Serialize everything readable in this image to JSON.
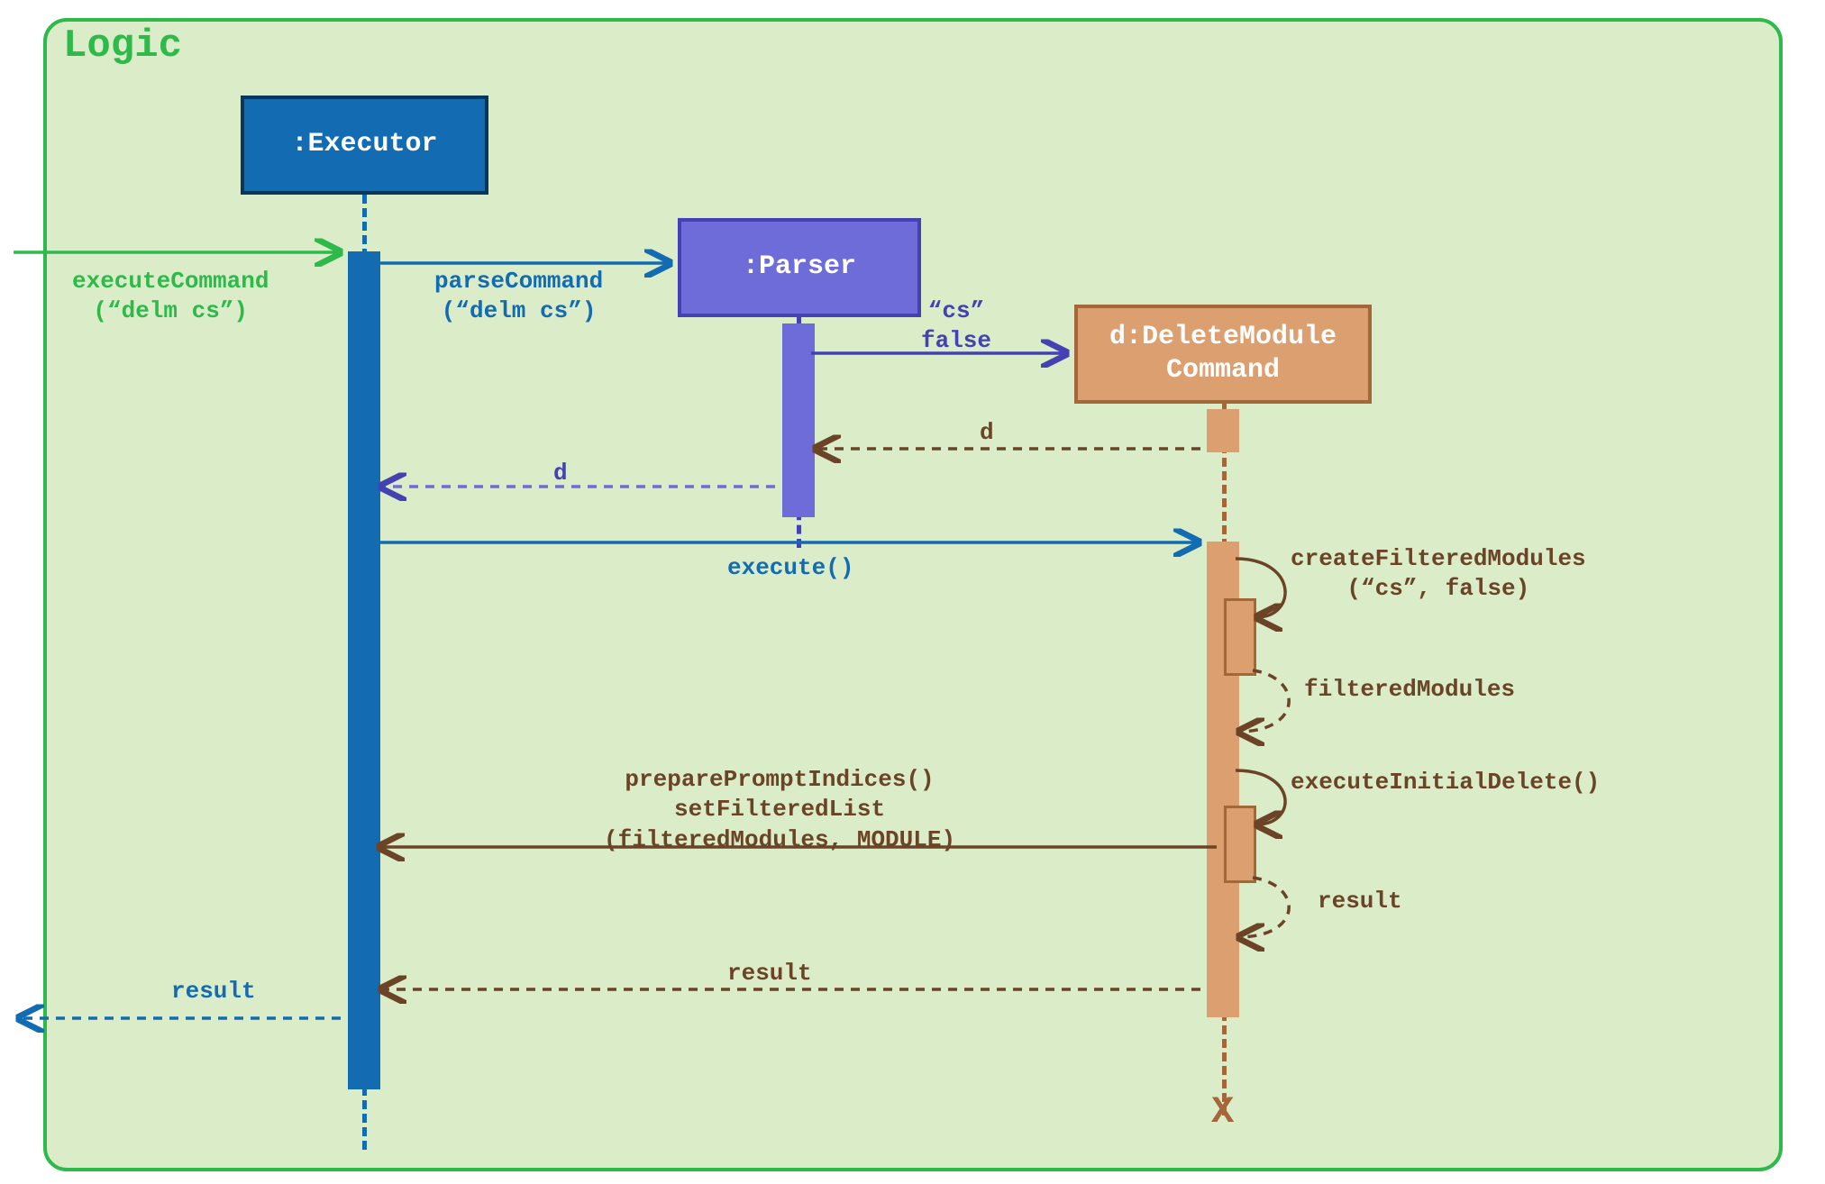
{
  "frame": {
    "title": "Logic"
  },
  "objects": {
    "executor": ":Executor",
    "parser": ":Parser",
    "deleteCmd": "d:DeleteModule\nCommand"
  },
  "messages": {
    "executeCommand": "executeCommand\n(“delm cs”)",
    "parseCommand": "parseCommand\n(“delm cs”)",
    "csFalse": "“cs”\nfalse",
    "d_to_parser": "d",
    "d_to_exec": "d",
    "execute": "execute()",
    "createFilteredModules": "createFilteredModules\n(“cs”, false)",
    "filteredModules": "filteredModules",
    "executeInitialDelete": "executeInitialDelete()",
    "prepare": "preparePromptIndices()\nsetFilteredList\n(filteredModules, MODULE)",
    "resultSelf": "result",
    "resultBack": "result",
    "resultOut": "result"
  },
  "colors": {
    "frame": "#2eba4a",
    "executor": "#136cb2",
    "parser": "#6e6cd8",
    "delete": "#dc9f70",
    "brownText": "#6b4428"
  }
}
